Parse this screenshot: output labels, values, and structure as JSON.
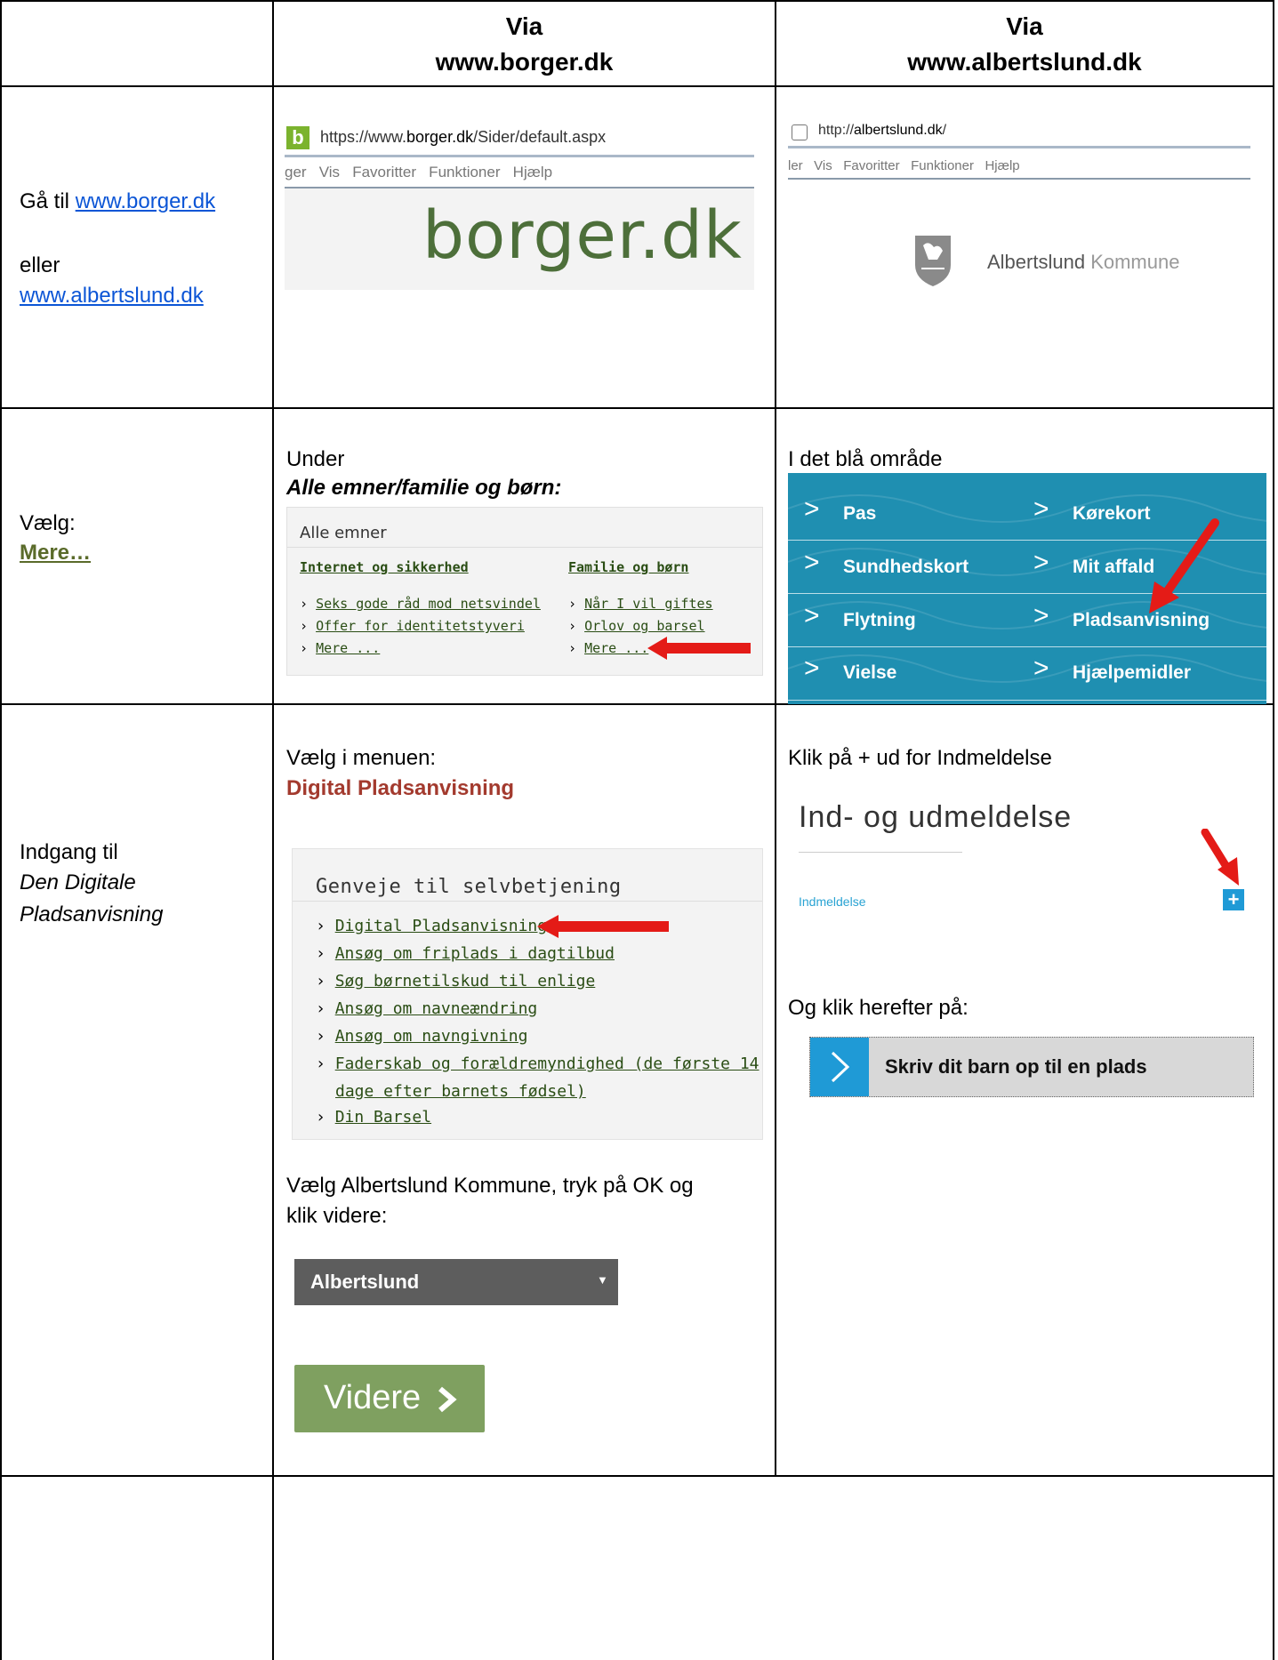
{
  "header": {
    "col2_line1": "Via",
    "col2_line2": "www.borger.dk",
    "col3_line1": "Via",
    "col3_line2": "www.albertslund.dk"
  },
  "row1": {
    "goto_prefix": "Gå til ",
    "goto_link": "www.borger.dk",
    "or": "eller",
    "alt_link": "www.albertslund.dk",
    "borger_url_prefix": "https://www.",
    "borger_url_bold": "borger.dk",
    "borger_url_suffix": "/Sider/default.aspx",
    "borger_menu": "ger   Vis   Favoritter   Funktioner   Hjælp",
    "borger_logo": "borger.dk",
    "borger_favicon": "b",
    "alb_url_prefix": "http://",
    "alb_url_bold": "albertslund.dk",
    "alb_url_suffix": "/",
    "alb_menu": "ler   Vis   Favoritter   Funktioner   Hjælp",
    "alb_logo_bold": "Albertslund",
    "alb_logo_light": " Kommune"
  },
  "row2": {
    "label": "Vælg:",
    "label_link": "Mere…",
    "borger_intro1": "Under",
    "borger_intro2": "Alle emner/familie og børn:",
    "ae_title": "Alle emner",
    "ae_col1_head": "Internet og sikkerhed",
    "ae_col1_items": [
      "Seks gode råd mod netsvindel",
      "Offer for identitetstyveri",
      "Mere ..."
    ],
    "ae_col2_head": "Familie og børn",
    "ae_col2_items": [
      "Når I vil giftes",
      "Orlov og barsel",
      "Mere ..."
    ],
    "alb_intro": "I det blå område",
    "blue_items_left": [
      "Pas",
      "Sundhedskort",
      "Flytning",
      "Vielse"
    ],
    "blue_items_right": [
      "Kørekort",
      "Mit affald",
      "Pladsanvisning",
      "Hjælpemidler"
    ],
    "blue_color": "#1f8fb1"
  },
  "row3": {
    "label1": "Indgang til",
    "label2": "Den Digitale",
    "label3": "Pladsanvisning",
    "borger_intro1": "Vælg i menuen:",
    "borger_intro2": "Digital Pladsanvisning",
    "gv_title": "Genveje til selvbetjening",
    "gv_items": [
      "Digital Pladsanvisning",
      "Ansøg om friplads i dagtilbud",
      "Søg børnetilskud til enlige",
      "Ansøg om navneændring",
      "Ansøg om navngivning",
      "Faderskab og forældremyndighed (de første 14",
      "dage efter barnets fødsel)",
      "Din Barsel"
    ],
    "borger_select_intro1": "Vælg Albertslund Kommune, tryk på OK og",
    "borger_select_intro2": "klik videre:",
    "select_value": "Albertslund",
    "videre_label": "Videre",
    "alb_intro": "Klik på + ud for Indmeldelse",
    "alb_heading": "Ind- og udmeldelse",
    "alb_item": "Indmeldelse",
    "alb_plus": "+",
    "alb_after": "Og klik herefter på:",
    "alb_button": "Skriv dit barn op til en plads",
    "accent_red": "#a33a2e",
    "videre_color": "#7fa060"
  }
}
